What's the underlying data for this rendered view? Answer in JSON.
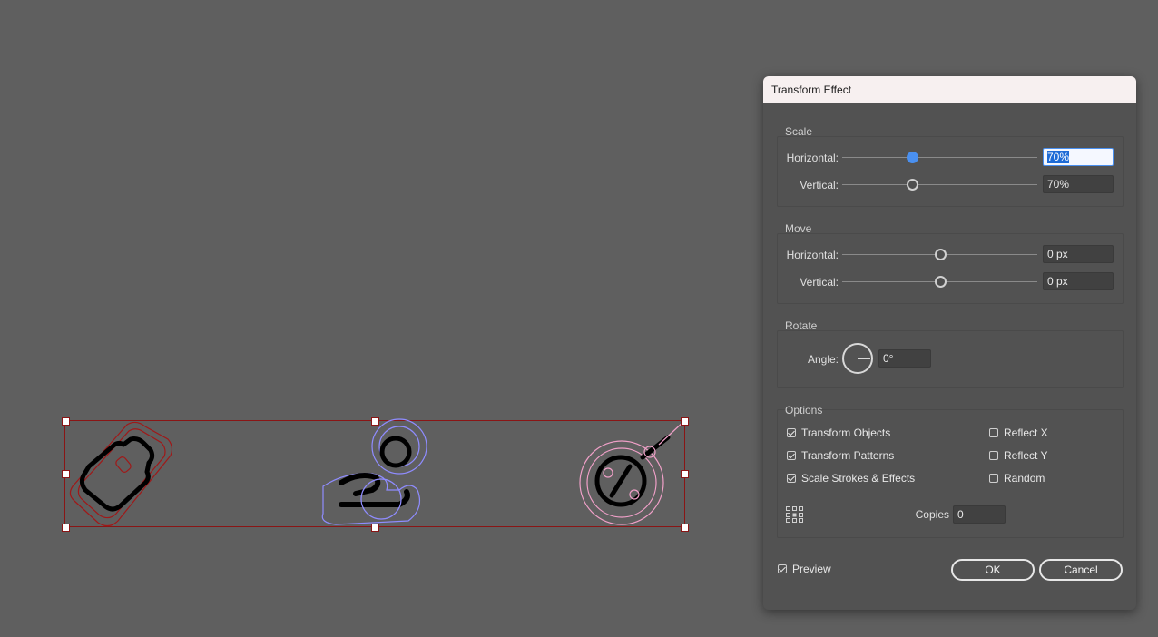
{
  "dialog": {
    "title": "Transform Effect",
    "scale": {
      "title": "Scale",
      "horizontal_label": "Horizontal:",
      "horizontal_value": "70%",
      "vertical_label": "Vertical:",
      "vertical_value": "70%"
    },
    "move": {
      "title": "Move",
      "horizontal_label": "Horizontal:",
      "horizontal_value": "0 px",
      "vertical_label": "Vertical:",
      "vertical_value": "0 px"
    },
    "rotate": {
      "title": "Rotate",
      "angle_label": "Angle:",
      "angle_value": "0°"
    },
    "options": {
      "title": "Options",
      "transform_objects": "Transform Objects",
      "transform_patterns": "Transform Patterns",
      "scale_strokes": "Scale Strokes & Effects",
      "reflect_x": "Reflect X",
      "reflect_y": "Reflect Y",
      "random": "Random",
      "copies_label": "Copies",
      "copies_value": "0"
    },
    "preview_label": "Preview",
    "ok_label": "OK",
    "cancel_label": "Cancel"
  },
  "colors": {
    "selection": "#8a1515",
    "accent": "#4a90f0",
    "icon_left_outline": "#a01818",
    "icon_middle_outline": "#8f8cff",
    "icon_right_outline": "#f0a0c8"
  },
  "icons": {
    "left": "price-tag-icon",
    "middle": "hand-holding-coin-icon",
    "right": "discount-tag-icon"
  }
}
